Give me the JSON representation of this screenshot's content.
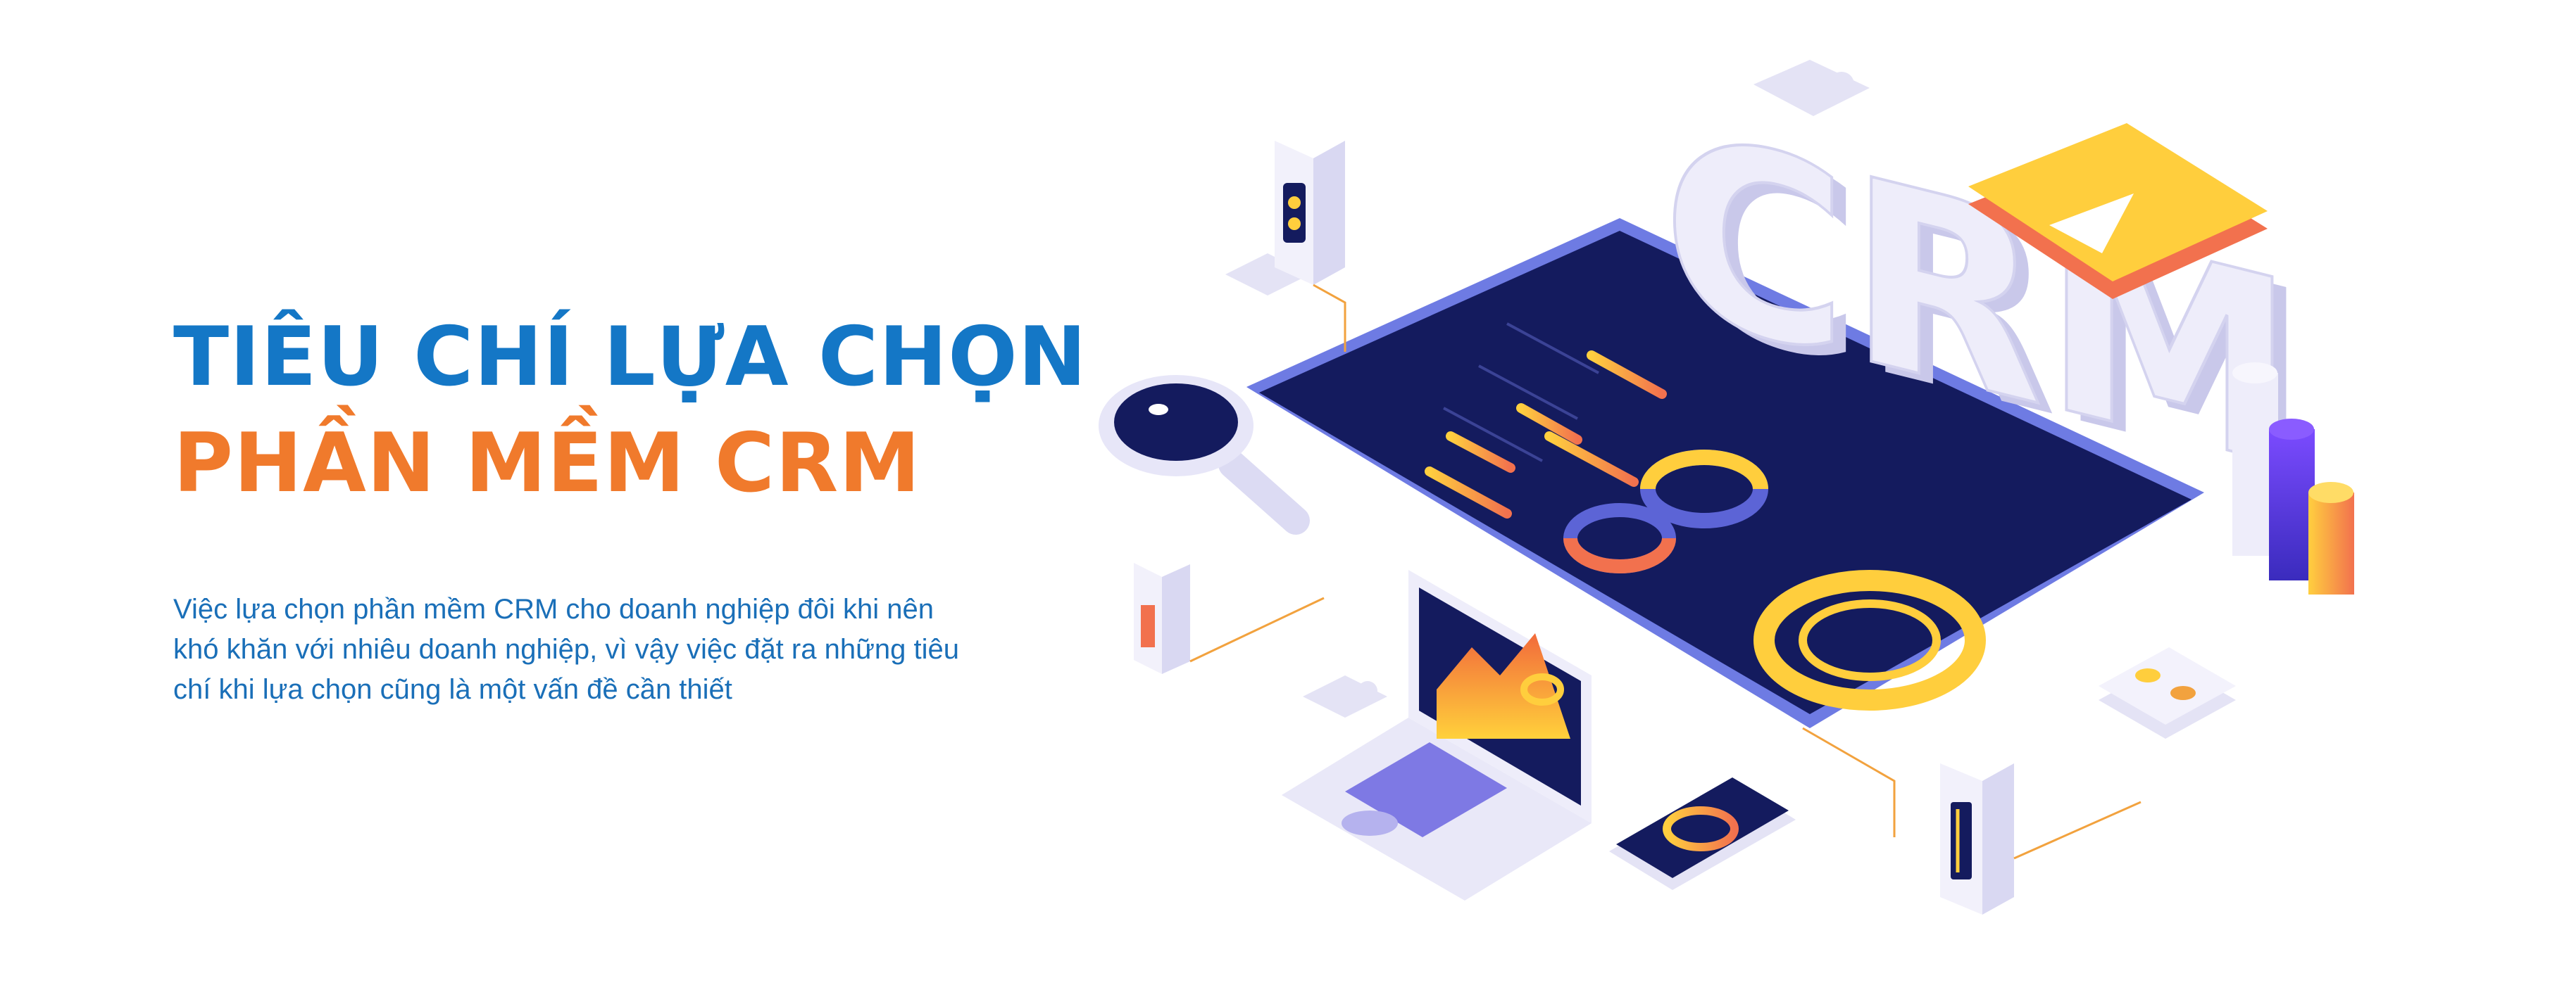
{
  "hero": {
    "title_line1": "TIÊU CHÍ LỰA CHỌN",
    "title_line2": "PHẦN MỀM CRM",
    "description_lines": [
      "Việc lựa chọn phần mềm CRM cho doanh nghiệp đôi khi nên",
      "khó khăn với nhiêu doanh nghiệp, vì vậy việc đặt ra những tiêu",
      "chí khi lựa chọn cũng là một vấn đề cần thiết"
    ]
  },
  "illustration": {
    "logo_text": "CRM",
    "icons": [
      "magnifier-icon",
      "laptop-icon",
      "phone-icon",
      "server-icon",
      "play-button-icon",
      "puzzle-icon",
      "coins-icon",
      "bar-chart-icon"
    ]
  },
  "colors": {
    "title_blue": "#1477c6",
    "title_orange": "#f07a2c",
    "desc_blue": "#1a6fb8",
    "navy": "#131a5c",
    "yellow": "#ffce3d",
    "purple": "#5b35d6",
    "lavender": "#e4e3f5"
  }
}
